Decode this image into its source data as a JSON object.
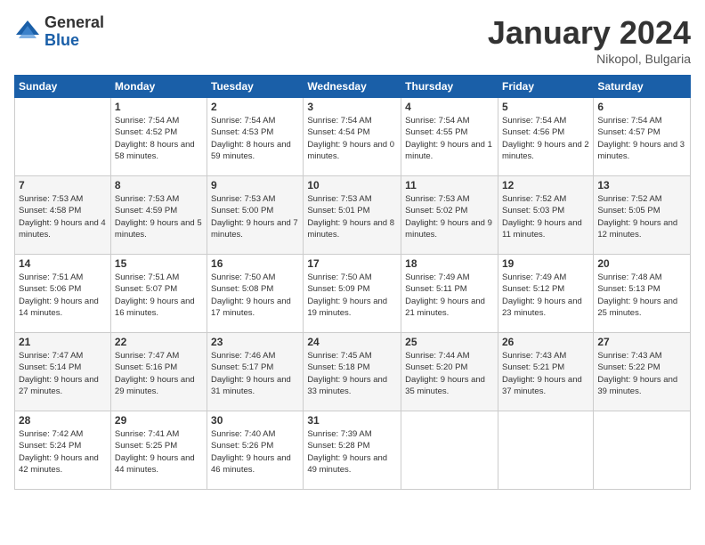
{
  "logo": {
    "general": "General",
    "blue": "Blue"
  },
  "header": {
    "title": "January 2024",
    "location": "Nikopol, Bulgaria"
  },
  "weekdays": [
    "Sunday",
    "Monday",
    "Tuesday",
    "Wednesday",
    "Thursday",
    "Friday",
    "Saturday"
  ],
  "weeks": [
    [
      {
        "day": "",
        "sunrise": "",
        "sunset": "",
        "daylight": ""
      },
      {
        "day": "1",
        "sunrise": "Sunrise: 7:54 AM",
        "sunset": "Sunset: 4:52 PM",
        "daylight": "Daylight: 8 hours and 58 minutes."
      },
      {
        "day": "2",
        "sunrise": "Sunrise: 7:54 AM",
        "sunset": "Sunset: 4:53 PM",
        "daylight": "Daylight: 8 hours and 59 minutes."
      },
      {
        "day": "3",
        "sunrise": "Sunrise: 7:54 AM",
        "sunset": "Sunset: 4:54 PM",
        "daylight": "Daylight: 9 hours and 0 minutes."
      },
      {
        "day": "4",
        "sunrise": "Sunrise: 7:54 AM",
        "sunset": "Sunset: 4:55 PM",
        "daylight": "Daylight: 9 hours and 1 minute."
      },
      {
        "day": "5",
        "sunrise": "Sunrise: 7:54 AM",
        "sunset": "Sunset: 4:56 PM",
        "daylight": "Daylight: 9 hours and 2 minutes."
      },
      {
        "day": "6",
        "sunrise": "Sunrise: 7:54 AM",
        "sunset": "Sunset: 4:57 PM",
        "daylight": "Daylight: 9 hours and 3 minutes."
      }
    ],
    [
      {
        "day": "7",
        "sunrise": "Sunrise: 7:53 AM",
        "sunset": "Sunset: 4:58 PM",
        "daylight": "Daylight: 9 hours and 4 minutes."
      },
      {
        "day": "8",
        "sunrise": "Sunrise: 7:53 AM",
        "sunset": "Sunset: 4:59 PM",
        "daylight": "Daylight: 9 hours and 5 minutes."
      },
      {
        "day": "9",
        "sunrise": "Sunrise: 7:53 AM",
        "sunset": "Sunset: 5:00 PM",
        "daylight": "Daylight: 9 hours and 7 minutes."
      },
      {
        "day": "10",
        "sunrise": "Sunrise: 7:53 AM",
        "sunset": "Sunset: 5:01 PM",
        "daylight": "Daylight: 9 hours and 8 minutes."
      },
      {
        "day": "11",
        "sunrise": "Sunrise: 7:53 AM",
        "sunset": "Sunset: 5:02 PM",
        "daylight": "Daylight: 9 hours and 9 minutes."
      },
      {
        "day": "12",
        "sunrise": "Sunrise: 7:52 AM",
        "sunset": "Sunset: 5:03 PM",
        "daylight": "Daylight: 9 hours and 11 minutes."
      },
      {
        "day": "13",
        "sunrise": "Sunrise: 7:52 AM",
        "sunset": "Sunset: 5:05 PM",
        "daylight": "Daylight: 9 hours and 12 minutes."
      }
    ],
    [
      {
        "day": "14",
        "sunrise": "Sunrise: 7:51 AM",
        "sunset": "Sunset: 5:06 PM",
        "daylight": "Daylight: 9 hours and 14 minutes."
      },
      {
        "day": "15",
        "sunrise": "Sunrise: 7:51 AM",
        "sunset": "Sunset: 5:07 PM",
        "daylight": "Daylight: 9 hours and 16 minutes."
      },
      {
        "day": "16",
        "sunrise": "Sunrise: 7:50 AM",
        "sunset": "Sunset: 5:08 PM",
        "daylight": "Daylight: 9 hours and 17 minutes."
      },
      {
        "day": "17",
        "sunrise": "Sunrise: 7:50 AM",
        "sunset": "Sunset: 5:09 PM",
        "daylight": "Daylight: 9 hours and 19 minutes."
      },
      {
        "day": "18",
        "sunrise": "Sunrise: 7:49 AM",
        "sunset": "Sunset: 5:11 PM",
        "daylight": "Daylight: 9 hours and 21 minutes."
      },
      {
        "day": "19",
        "sunrise": "Sunrise: 7:49 AM",
        "sunset": "Sunset: 5:12 PM",
        "daylight": "Daylight: 9 hours and 23 minutes."
      },
      {
        "day": "20",
        "sunrise": "Sunrise: 7:48 AM",
        "sunset": "Sunset: 5:13 PM",
        "daylight": "Daylight: 9 hours and 25 minutes."
      }
    ],
    [
      {
        "day": "21",
        "sunrise": "Sunrise: 7:47 AM",
        "sunset": "Sunset: 5:14 PM",
        "daylight": "Daylight: 9 hours and 27 minutes."
      },
      {
        "day": "22",
        "sunrise": "Sunrise: 7:47 AM",
        "sunset": "Sunset: 5:16 PM",
        "daylight": "Daylight: 9 hours and 29 minutes."
      },
      {
        "day": "23",
        "sunrise": "Sunrise: 7:46 AM",
        "sunset": "Sunset: 5:17 PM",
        "daylight": "Daylight: 9 hours and 31 minutes."
      },
      {
        "day": "24",
        "sunrise": "Sunrise: 7:45 AM",
        "sunset": "Sunset: 5:18 PM",
        "daylight": "Daylight: 9 hours and 33 minutes."
      },
      {
        "day": "25",
        "sunrise": "Sunrise: 7:44 AM",
        "sunset": "Sunset: 5:20 PM",
        "daylight": "Daylight: 9 hours and 35 minutes."
      },
      {
        "day": "26",
        "sunrise": "Sunrise: 7:43 AM",
        "sunset": "Sunset: 5:21 PM",
        "daylight": "Daylight: 9 hours and 37 minutes."
      },
      {
        "day": "27",
        "sunrise": "Sunrise: 7:43 AM",
        "sunset": "Sunset: 5:22 PM",
        "daylight": "Daylight: 9 hours and 39 minutes."
      }
    ],
    [
      {
        "day": "28",
        "sunrise": "Sunrise: 7:42 AM",
        "sunset": "Sunset: 5:24 PM",
        "daylight": "Daylight: 9 hours and 42 minutes."
      },
      {
        "day": "29",
        "sunrise": "Sunrise: 7:41 AM",
        "sunset": "Sunset: 5:25 PM",
        "daylight": "Daylight: 9 hours and 44 minutes."
      },
      {
        "day": "30",
        "sunrise": "Sunrise: 7:40 AM",
        "sunset": "Sunset: 5:26 PM",
        "daylight": "Daylight: 9 hours and 46 minutes."
      },
      {
        "day": "31",
        "sunrise": "Sunrise: 7:39 AM",
        "sunset": "Sunset: 5:28 PM",
        "daylight": "Daylight: 9 hours and 49 minutes."
      },
      {
        "day": "",
        "sunrise": "",
        "sunset": "",
        "daylight": ""
      },
      {
        "day": "",
        "sunrise": "",
        "sunset": "",
        "daylight": ""
      },
      {
        "day": "",
        "sunrise": "",
        "sunset": "",
        "daylight": ""
      }
    ]
  ]
}
